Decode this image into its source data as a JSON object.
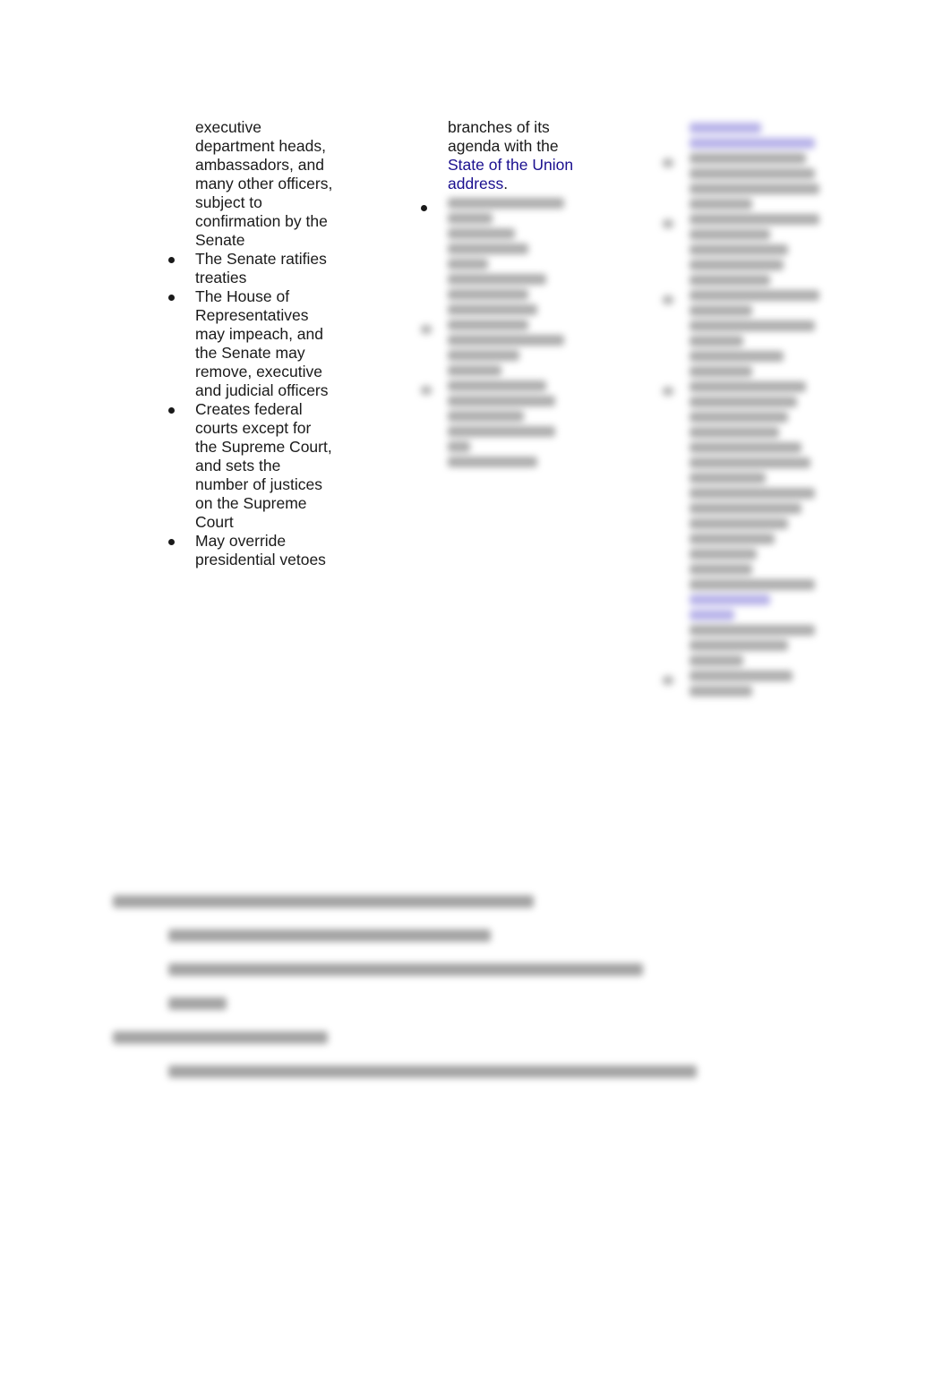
{
  "left_column": {
    "continuation": "executive department heads, ambassadors, and many other officers, subject to confirmation by the Senate",
    "items": [
      {
        "text": "The Senate ratifies treaties"
      },
      {
        "text": "The House of Representatives may impeach, and the Senate may remove, executive and judicial officers"
      },
      {
        "text": "Creates federal courts except for the Supreme Court, and sets the number of justices on the Supreme Court"
      },
      {
        "text": "May override presidential vetoes"
      }
    ]
  },
  "middle_column": {
    "continuation_text": "branches of its agenda with the ",
    "continuation_link": "State of the Union address",
    "continuation_end": ".",
    "blurred_note": "remaining content blurred"
  },
  "right_column": {
    "blurred_note": "content blurred"
  },
  "bottom_section": {
    "blurred_note": "content blurred"
  }
}
